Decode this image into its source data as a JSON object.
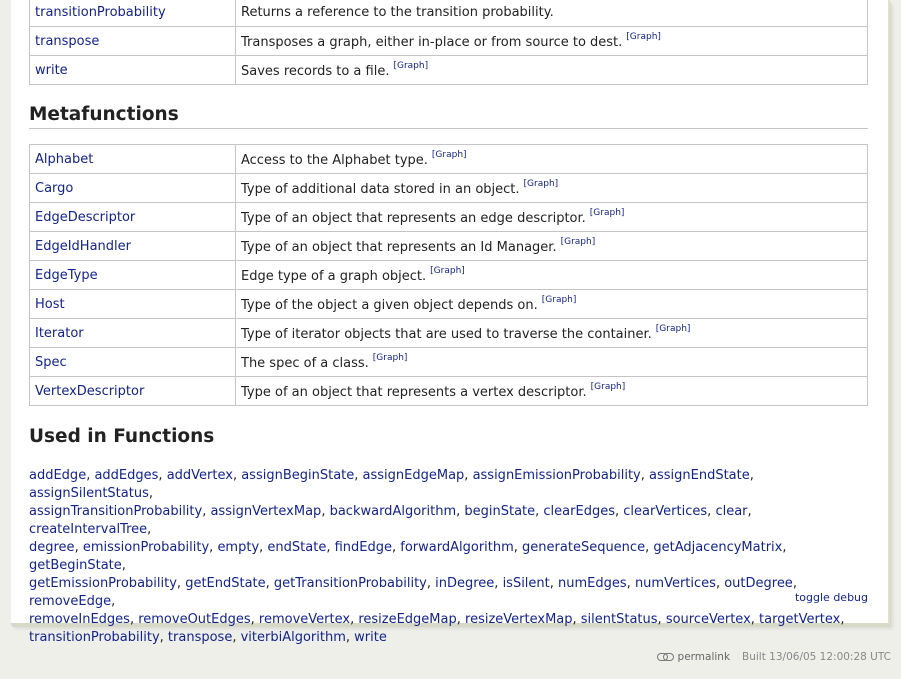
{
  "top_table": [
    {
      "name": "transitionProbability",
      "desc": "Returns a reference to the transition probability.",
      "tag": ""
    },
    {
      "name": "transpose",
      "desc": "Transposes a graph, either in-place or from source to dest.",
      "tag": "[Graph]"
    },
    {
      "name": "write",
      "desc": "Saves records to a file.",
      "tag": "[Graph]"
    }
  ],
  "metafunctions": {
    "heading": "Metafunctions",
    "rows": [
      {
        "name": "Alphabet",
        "desc": "Access to the Alphabet type.",
        "tag": "[Graph]"
      },
      {
        "name": "Cargo",
        "desc": "Type of additional data stored in an object.",
        "tag": "[Graph]"
      },
      {
        "name": "EdgeDescriptor",
        "desc": "Type of an object that represents an edge descriptor.",
        "tag": "[Graph]"
      },
      {
        "name": "EdgeIdHandler",
        "desc": "Type of an object that represents an Id Manager.",
        "tag": "[Graph]"
      },
      {
        "name": "EdgeType",
        "desc": "Edge type of a graph object.",
        "tag": "[Graph]"
      },
      {
        "name": "Host",
        "desc": "Type of the object a given object depends on.",
        "tag": "[Graph]"
      },
      {
        "name": "Iterator",
        "desc": "Type of iterator objects that are used to traverse the container.",
        "tag": "[Graph]"
      },
      {
        "name": "Spec",
        "desc": "The spec of a class.",
        "tag": "[Graph]"
      },
      {
        "name": "VertexDescriptor",
        "desc": "Type of an object that represents a vertex descriptor.",
        "tag": "[Graph]"
      }
    ]
  },
  "used_in_functions": {
    "heading": "Used in Functions",
    "lines": [
      [
        "addEdge",
        "addEdges",
        "addVertex",
        "assignBeginState",
        "assignEdgeMap",
        "assignEmissionProbability",
        "assignEndState",
        "assignSilentStatus"
      ],
      [
        "assignTransitionProbability",
        "assignVertexMap",
        "backwardAlgorithm",
        "beginState",
        "clearEdges",
        "clearVertices",
        "clear",
        "createIntervalTree"
      ],
      [
        "degree",
        "emissionProbability",
        "empty",
        "endState",
        "findEdge",
        "forwardAlgorithm",
        "generateSequence",
        "getAdjacencyMatrix",
        "getBeginState"
      ],
      [
        "getEmissionProbability",
        "getEndState",
        "getTransitionProbability",
        "inDegree",
        "isSilent",
        "numEdges",
        "numVertices",
        "outDegree",
        "removeEdge"
      ],
      [
        "removeInEdges",
        "removeOutEdges",
        "removeVertex",
        "resizeEdgeMap",
        "resizeVertexMap",
        "silentStatus",
        "sourceVertex",
        "targetVertex"
      ],
      [
        "transitionProbability",
        "transpose",
        "viterbiAlgorithm",
        "write"
      ]
    ]
  },
  "toggle_debug": "toggle debug",
  "footer": {
    "permalink": "permalink",
    "built": "Built 13/06/05 12:00:28 UTC"
  }
}
